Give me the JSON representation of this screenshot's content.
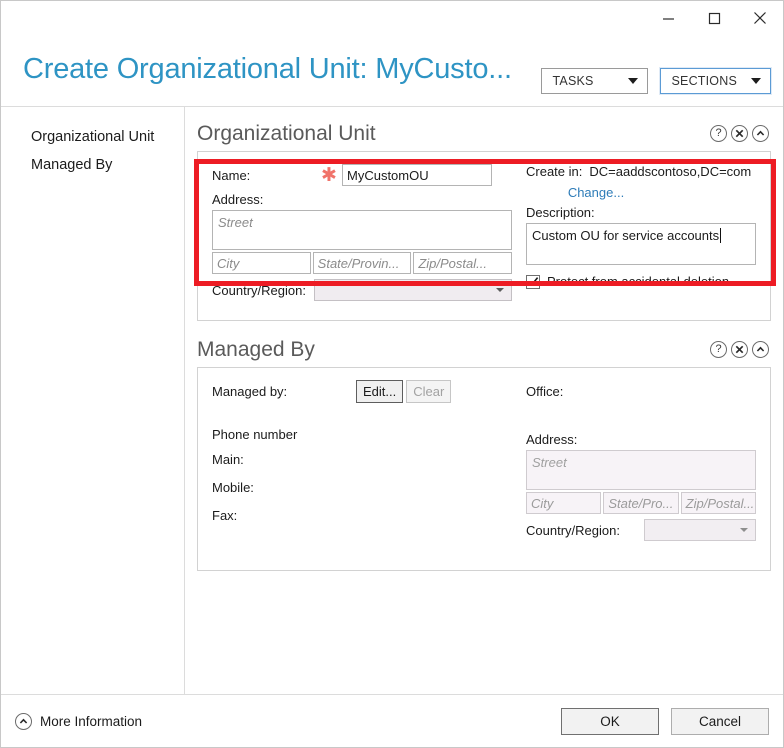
{
  "window": {
    "controls": {
      "minimize": "minimize-icon",
      "maximize": "maximize-icon",
      "close": "close-icon"
    }
  },
  "header": {
    "title": "Create Organizational Unit: MyCusto...",
    "title_color": "#2e94c4",
    "tasks_button": "TASKS",
    "sections_button": "SECTIONS"
  },
  "sidebar": {
    "items": [
      {
        "label": "Organizational Unit"
      },
      {
        "label": "Managed By"
      }
    ]
  },
  "sections": [
    {
      "title": "Organizational Unit",
      "icons": {
        "help": "?",
        "close": "x",
        "collapse": "^"
      },
      "left": {
        "name_label": "Name:",
        "name_required_marker": "*",
        "name_value": "MyCustomOU",
        "address_label": "Address:",
        "street_placeholder": "Street",
        "city_placeholder": "City",
        "state_placeholder": "State/Provin...",
        "zip_placeholder": "Zip/Postal...",
        "country_label": "Country/Region:",
        "country_value": ""
      },
      "right": {
        "create_in_label": "Create in:",
        "create_in_value": "DC=aaddscontoso,DC=com",
        "change_link": "Change...",
        "description_label": "Description:",
        "description_value": "Custom OU for service accounts",
        "protect_checkbox_label": "Protect from accidental deletion",
        "protect_checked": true
      }
    },
    {
      "title": "Managed By",
      "icons": {
        "help": "?",
        "close": "x",
        "collapse": "^"
      },
      "left": {
        "managed_by_label": "Managed by:",
        "edit_button": "Edit...",
        "clear_button": "Clear",
        "clear_disabled": true,
        "phone_number_label": "Phone number",
        "main_label": "Main:",
        "mobile_label": "Mobile:",
        "fax_label": "Fax:"
      },
      "right": {
        "office_label": "Office:",
        "address_label": "Address:",
        "street_placeholder": "Street",
        "city_placeholder": "City",
        "state_placeholder": "State/Pro...",
        "zip_placeholder": "Zip/Postal...",
        "country_label": "Country/Region:",
        "country_value": ""
      }
    }
  ],
  "annotation": {
    "color": "#ed1c24"
  },
  "footer": {
    "more_information": "More Information",
    "ok_button": "OK",
    "cancel_button": "Cancel"
  }
}
